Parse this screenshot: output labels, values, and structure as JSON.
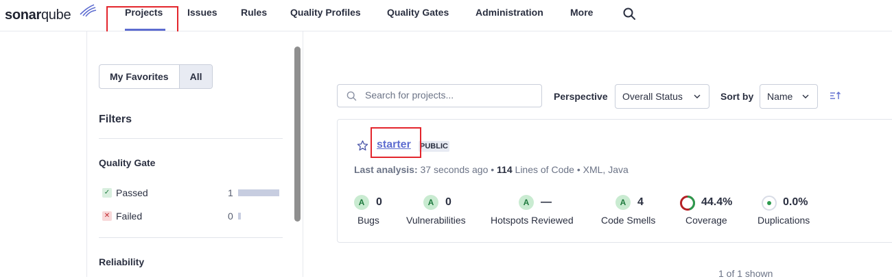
{
  "brand": {
    "sonar": "sonar",
    "qube": "qube"
  },
  "nav": {
    "items": [
      "Projects",
      "Issues",
      "Rules",
      "Quality Profiles",
      "Quality Gates",
      "Administration",
      "More"
    ],
    "active": "Projects"
  },
  "sidebar": {
    "toggle": {
      "favorites": "My Favorites",
      "all": "All",
      "selected": "All"
    },
    "filters_title": "Filters",
    "quality_gate": {
      "title": "Quality Gate",
      "options": [
        {
          "label": "Passed",
          "count": "1",
          "share": 1.0
        },
        {
          "label": "Failed",
          "count": "0",
          "share": 0.0
        }
      ]
    },
    "reliability_title": "Reliability"
  },
  "toolbar": {
    "search_placeholder": "Search for projects...",
    "perspective_label": "Perspective",
    "perspective_value": "Overall Status",
    "sort_label": "Sort by",
    "sort_value": "Name"
  },
  "project": {
    "name": "starter",
    "visibility": "PUBLIC",
    "last_analysis_label": "Last analysis:",
    "last_analysis_value": "37 seconds ago",
    "loc_value": "114",
    "loc_label": "Lines of Code",
    "languages": "XML, Java",
    "metrics": {
      "bugs": {
        "rating": "A",
        "value": "0",
        "label": "Bugs"
      },
      "vulnerabilities": {
        "rating": "A",
        "value": "0",
        "label": "Vulnerabilities"
      },
      "hotspots": {
        "rating": "A",
        "value": "—",
        "label": "Hotspots Reviewed"
      },
      "code_smells": {
        "rating": "A",
        "value": "4",
        "label": "Code Smells"
      },
      "coverage": {
        "value": "44.4%",
        "label": "Coverage",
        "percent": 44.4
      },
      "duplications": {
        "value": "0.0%",
        "label": "Duplications"
      }
    }
  },
  "footer": {
    "shown": "1 of 1 shown"
  },
  "colors": {
    "accent": "#5d6cd0",
    "highlight": "#e3242b",
    "pass": "#1f7a3e",
    "fail": "#c0272d"
  }
}
